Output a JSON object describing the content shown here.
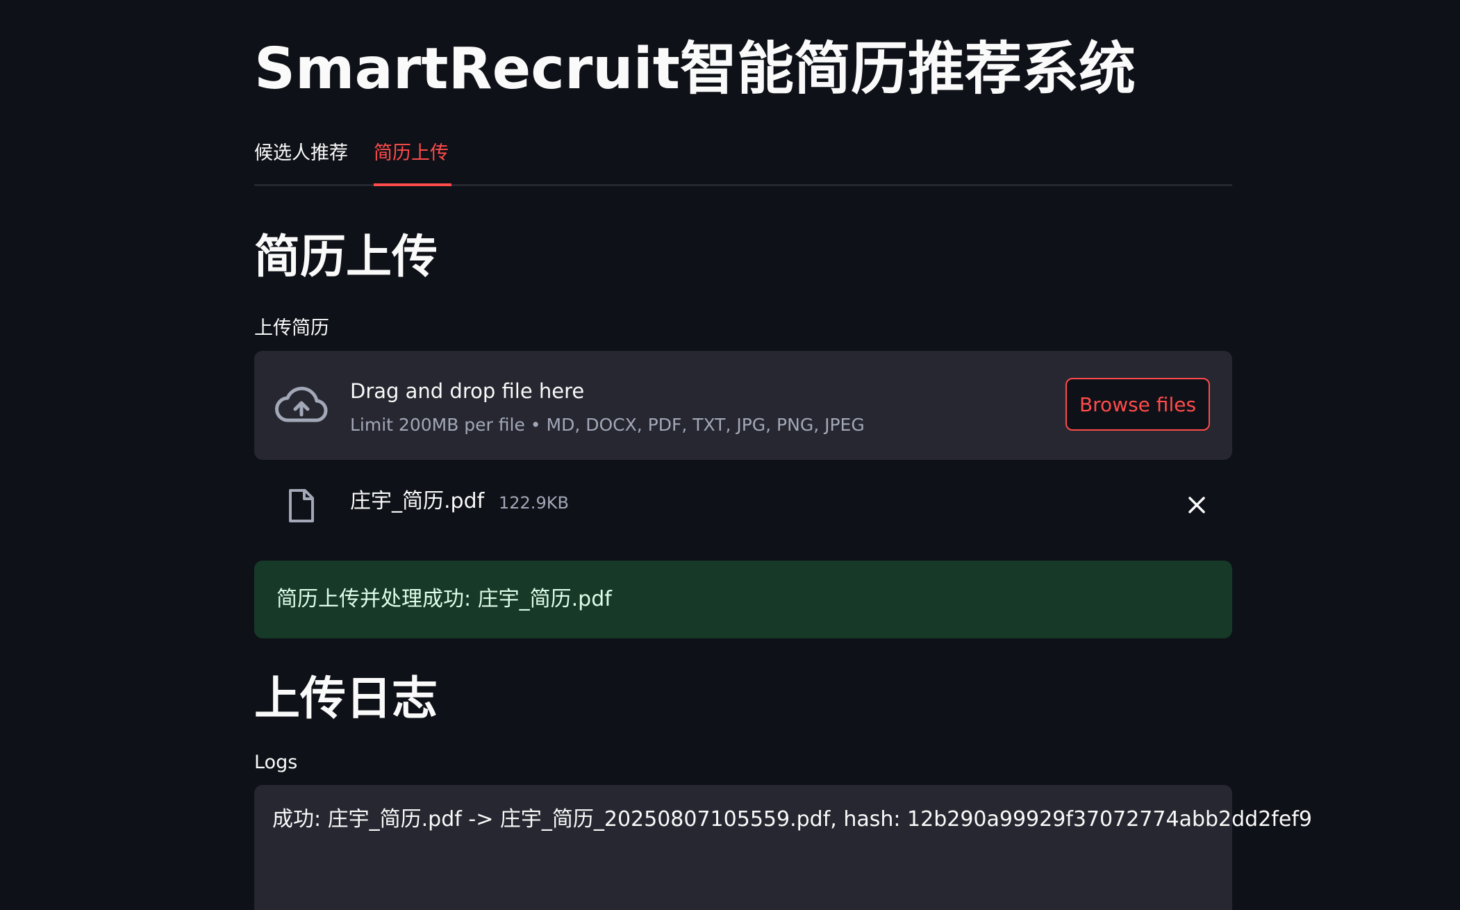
{
  "app": {
    "title": "SmartRecruit智能简历推荐系统"
  },
  "tabs": [
    {
      "label": "候选人推荐",
      "active": false
    },
    {
      "label": "简历上传",
      "active": true
    }
  ],
  "upload_section": {
    "heading": "简历上传",
    "field_label": "上传简历",
    "dropzone": {
      "title": "Drag and drop file here",
      "subtitle": "Limit 200MB per file • MD, DOCX, PDF, TXT, JPG, PNG, JPEG",
      "browse_label": "Browse files",
      "icon": "cloud-upload-icon"
    },
    "uploaded_file": {
      "name": "庄宇_简历.pdf",
      "size": "122.9KB",
      "icon": "file-icon"
    },
    "success_message": "简历上传并处理成功: 庄宇_简历.pdf"
  },
  "log_section": {
    "heading": "上传日志",
    "field_label": "Logs",
    "log_text": "成功: 庄宇_简历.pdf -> 庄宇_简历_20250807105559.pdf, hash: 12b290a99929f37072774abb2dd2fef9"
  },
  "colors": {
    "background": "#0e1117",
    "surface": "#262730",
    "accent": "#ff4b4b",
    "success_bg": "#173928",
    "success_text": "#dffde9"
  }
}
